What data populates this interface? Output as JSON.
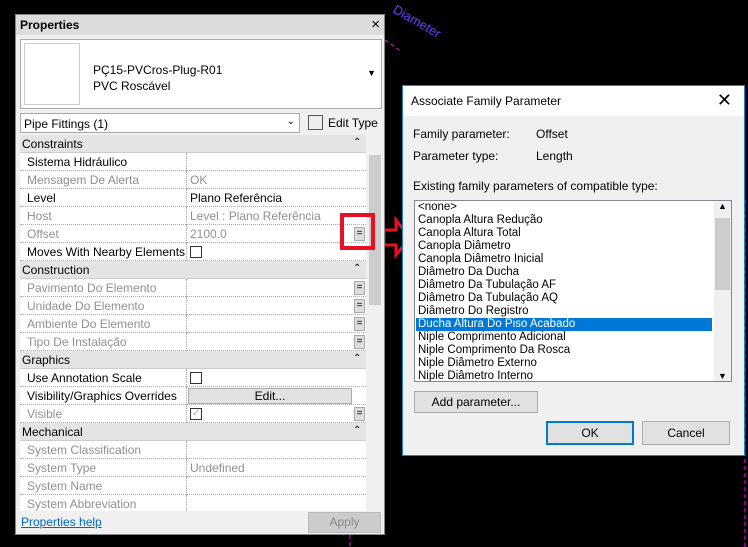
{
  "canvas": {
    "annotation": "Diameter"
  },
  "properties": {
    "title": "Properties",
    "close": "×",
    "type_name": "PÇ15-PVCros-Plug-R01",
    "type_sub": "PVC Roscável",
    "category": "Pipe Fittings (1)",
    "edit_type": "Edit Type",
    "rows": [
      {
        "kind": "hdr",
        "label": "Constraints"
      },
      {
        "label": "Sistema Hidráulico",
        "value": ""
      },
      {
        "label": "Mensagem De Alerta",
        "value": "OK",
        "grey": true
      },
      {
        "label": "Level",
        "value": "Plano Referência"
      },
      {
        "label": "Host",
        "value": "Level : Plano Referência",
        "grey": true
      },
      {
        "label": "Offset",
        "value": "2100.0",
        "grey": true,
        "eq": true
      },
      {
        "label": "Moves With Nearby Elements",
        "checkbox": false
      },
      {
        "kind": "hdr",
        "label": "Construction"
      },
      {
        "label": "Pavimento Do Elemento",
        "value": "",
        "grey": true,
        "eq": true
      },
      {
        "label": "Unidade Do Elemento",
        "value": "",
        "grey": true,
        "eq": true
      },
      {
        "label": "Ambiente Do Elemento",
        "value": "",
        "grey": true,
        "eq": true
      },
      {
        "label": "Tipo De Instalação",
        "value": "",
        "grey": true,
        "eq": true
      },
      {
        "kind": "hdr",
        "label": "Graphics"
      },
      {
        "label": "Use Annotation Scale",
        "checkbox": false
      },
      {
        "label": "Visibility/Graphics Overrides",
        "button": "Edit..."
      },
      {
        "label": "Visible",
        "checkbox": true,
        "grey": true,
        "eq": true
      },
      {
        "kind": "hdr",
        "label": "Mechanical"
      },
      {
        "label": "System Classification",
        "value": "",
        "grey": true
      },
      {
        "label": "System Type",
        "value": "Undefined",
        "grey": true
      },
      {
        "label": "System Name",
        "value": "",
        "grey": true
      },
      {
        "label": "System Abbreviation",
        "value": "",
        "grey": true
      }
    ],
    "help": "Properties help",
    "apply": "Apply"
  },
  "dialog": {
    "title": "Associate Family Parameter",
    "close": "✕",
    "family_parameter_label": "Family parameter:",
    "family_parameter": "Offset",
    "parameter_type_label": "Parameter type:",
    "parameter_type": "Length",
    "list_label": "Existing family parameters of compatible type:",
    "items": [
      "<none>",
      "Canopla Altura Redução",
      "Canopla Altura Total",
      "Canopla Diâmetro",
      "Canopla Diâmetro Inicial",
      "Diâmetro Da Ducha",
      "Diâmetro Da Tubulação AF",
      "Diâmetro Da Tubulação AQ",
      "Diâmetro Do Registro",
      "Ducha Altura Do Piso Acabado",
      "Niple Comprimento Adicional",
      "Niple Comprimento Da Rosca",
      "Niple Diâmetro Externo",
      "Niple Diâmetro Interno"
    ],
    "selected": "Ducha Altura Do Piso Acabado",
    "add_parameter": "Add parameter...",
    "ok": "OK",
    "cancel": "Cancel"
  },
  "colors": {
    "highlight": "#e81123",
    "selection": "#0078d7",
    "cad_annotation": "#6a3cff"
  }
}
